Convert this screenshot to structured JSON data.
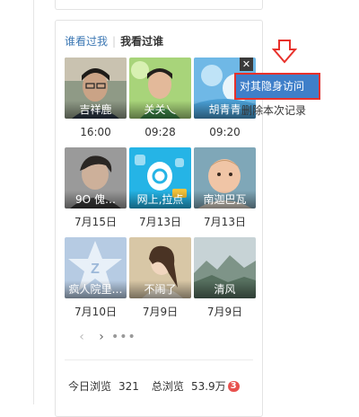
{
  "tabs": {
    "who_viewed": "谁看过我",
    "i_viewed": "我看过谁"
  },
  "visits": [
    {
      "name": "吉祥鹿",
      "time": "16:00"
    },
    {
      "name": "关关乀",
      "time": "09:28"
    },
    {
      "name": "胡青青",
      "time": "09:20"
    },
    {
      "name": "9O 傀…",
      "time": "7月15日"
    },
    {
      "name": "网上,拉点",
      "time": "7月13日"
    },
    {
      "name": "南迦巴瓦",
      "time": "7月13日"
    },
    {
      "name": "疯人院里…",
      "time": "7月10日"
    },
    {
      "name": "不闹了",
      "time": "7月9日"
    },
    {
      "name": "清风",
      "time": "7月9日"
    }
  ],
  "context_menu": {
    "hide_visit": "对其隐身访问",
    "delete_record": "删除本次记录"
  },
  "close_glyph": "✕",
  "pager": {
    "prev": "‹",
    "next": "›",
    "more": "•••"
  },
  "stats": {
    "today_label": "今日浏览",
    "today_value": "321",
    "total_label": "总浏览",
    "total_value": "53.9万",
    "badge": "3"
  },
  "colors": {
    "link_blue": "#3d78b4",
    "menu_highlight": "#3f7fc9",
    "highlight_border": "#e8312b",
    "badge_red": "#e8514e",
    "arrow_red": "#e8312b"
  }
}
